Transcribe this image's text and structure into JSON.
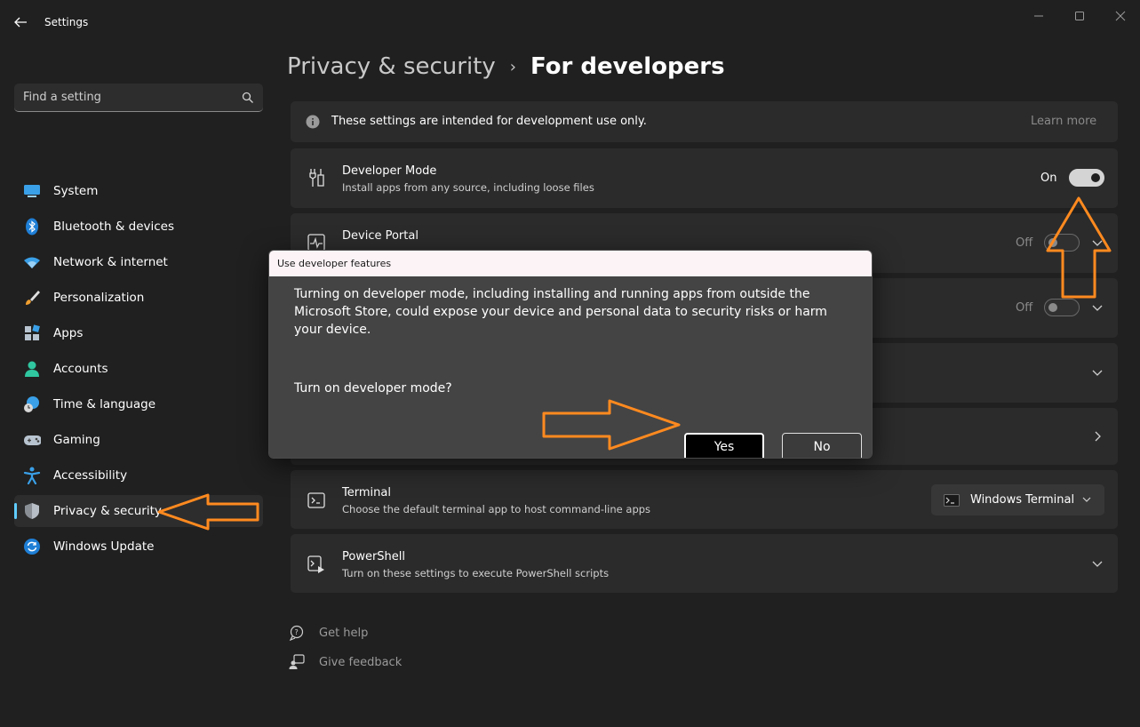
{
  "window": {
    "app_title": "Settings",
    "accent_color": "#60cdff",
    "annotation_color": "#ff8a1f"
  },
  "search": {
    "placeholder": "Find a setting"
  },
  "sidebar": {
    "items": [
      {
        "label": "System",
        "icon": "monitor-icon"
      },
      {
        "label": "Bluetooth & devices",
        "icon": "bluetooth-icon"
      },
      {
        "label": "Network & internet",
        "icon": "wifi-icon"
      },
      {
        "label": "Personalization",
        "icon": "paintbrush-icon"
      },
      {
        "label": "Apps",
        "icon": "apps-icon"
      },
      {
        "label": "Accounts",
        "icon": "person-icon"
      },
      {
        "label": "Time & language",
        "icon": "globe-clock-icon"
      },
      {
        "label": "Gaming",
        "icon": "gamepad-icon"
      },
      {
        "label": "Accessibility",
        "icon": "accessibility-icon"
      },
      {
        "label": "Privacy & security",
        "icon": "shield-icon",
        "selected": true
      },
      {
        "label": "Windows Update",
        "icon": "refresh-icon"
      }
    ]
  },
  "breadcrumb": {
    "parent": "Privacy & security",
    "separator": "›",
    "current": "For developers"
  },
  "info_banner": {
    "text": "These settings are intended for development use only.",
    "link": "Learn more"
  },
  "settings": {
    "developer_mode": {
      "title": "Developer Mode",
      "subtitle": "Install apps from any source, including loose files",
      "state": "On"
    },
    "device_portal": {
      "title": "Device Portal",
      "state": "Off"
    },
    "row3": {
      "state": "Off"
    },
    "terminal": {
      "title": "Terminal",
      "subtitle": "Choose the default terminal app to host command-line apps",
      "value": "Windows Terminal"
    },
    "powershell": {
      "title": "PowerShell",
      "subtitle": "Turn on these settings to execute PowerShell scripts"
    }
  },
  "footer": {
    "get_help": "Get help",
    "give_feedback": "Give feedback"
  },
  "dialog": {
    "title": "Use developer features",
    "message": "Turning on developer mode, including installing and running apps from outside the Microsoft Store, could expose your device and personal data to security risks or harm your device.",
    "question": "Turn on developer mode?",
    "yes": "Yes",
    "no": "No"
  }
}
